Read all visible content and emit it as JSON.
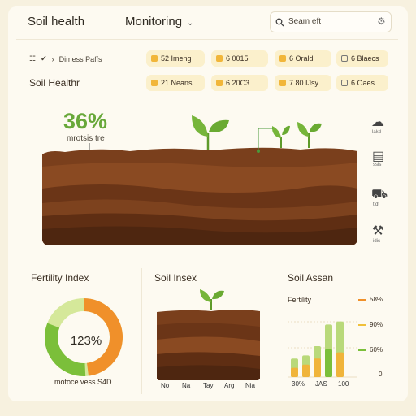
{
  "header": {
    "app_title": "Soil health",
    "nav_label": "Monitoring",
    "search_text": "Seam eft"
  },
  "toolbar": {
    "crumbs": [
      "Dimess Paffs"
    ],
    "chips_row1": [
      "52 Imeng",
      "6 0015",
      "6 Orald",
      "6 Blaecs"
    ],
    "chips_row2": [
      "21 Neans",
      "6 20C3",
      "7 80 IJsy",
      "6 Oaes"
    ]
  },
  "main": {
    "section_title": "Soil Healthr",
    "hero_stat": "36%",
    "hero_caption": "mrotsis tre",
    "side_tools": [
      "lakd",
      "ssis",
      "tidt",
      "idic"
    ]
  },
  "cards": {
    "fertility": {
      "title": "Fertility Index",
      "value": "123%",
      "caption": "motoce vess S4D",
      "ring_fraction": 0.48
    },
    "soil_index": {
      "title": "Soil Insex",
      "months": [
        "No",
        "Na",
        "Tay",
        "Arg",
        "Nia"
      ]
    },
    "soil_assan": {
      "title": "Soil Assan",
      "legend_title": "Fertility",
      "legend": [
        "58%",
        "90%",
        "60%"
      ],
      "legend_colors": [
        "#f0902a",
        "#f0c03a",
        "#7bbf3a"
      ],
      "axis_labels": [
        "30%",
        "JAS",
        "100"
      ],
      "bars": [
        {
          "green": 0.3,
          "orange": 0.15
        },
        {
          "green": 0.35,
          "orange": 0.2
        },
        {
          "green": 0.5,
          "orange": 0.3
        },
        {
          "green": 0.85,
          "orange": 0.45
        },
        {
          "green": 0.9,
          "orange": 0.4
        }
      ]
    }
  },
  "colors": {
    "accent_green": "#68a83a",
    "accent_orange": "#f0902a",
    "soil_dark": "#5a3016"
  }
}
